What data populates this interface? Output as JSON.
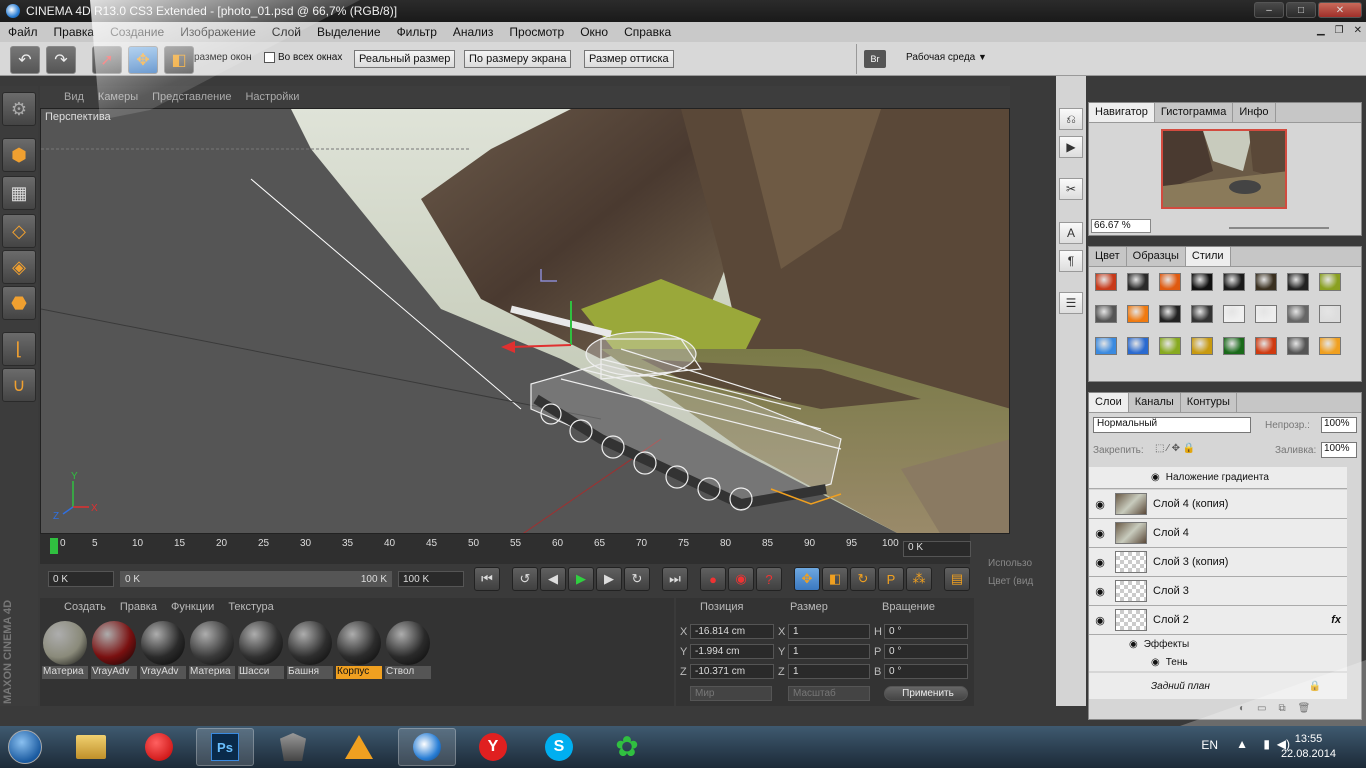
{
  "window": {
    "title": "CINEMA 4D R13.0 CS3 Extended - [photo_01.psd @ 66,7% (RGB/8)]",
    "controls": [
      "–",
      "□",
      "✕"
    ]
  },
  "menu": [
    "Файл",
    "Правка",
    "Создание",
    "Изображение",
    "Слой",
    "Выделение",
    "Фильтр",
    "Анализ",
    "Просмотр",
    "Окно",
    "Справка"
  ],
  "options": {
    "resize_windows_label": "размер окон",
    "all_windows_label": "Во всех окнах",
    "actual_size": "Реальный размер",
    "fit_screen": "По размеру экрана",
    "print_size": "Размер оттиска",
    "workspace": "Рабочая среда"
  },
  "viewport": {
    "menu": [
      "Вид",
      "Камеры",
      "Представление",
      "Настройки"
    ],
    "label": "Перспектива",
    "axes": {
      "y": "Y",
      "x": "X",
      "z": "Z"
    }
  },
  "timeline": {
    "ticks": [
      "0",
      "5",
      "10",
      "15",
      "20",
      "25",
      "30",
      "35",
      "40",
      "45",
      "50",
      "55",
      "60",
      "65",
      "70",
      "75",
      "80",
      "85",
      "90",
      "95",
      "100"
    ],
    "current_frame": "0 K"
  },
  "transport": {
    "start": "0 K",
    "range_start": "0 K",
    "range_end": "100 K",
    "end": "100 K"
  },
  "materials": {
    "menu": [
      "Создать",
      "Правка",
      "Функции",
      "Текстура"
    ],
    "items": [
      {
        "name": "Материа",
        "color": "#8a8a7a",
        "active": false
      },
      {
        "name": "VrayAdv",
        "color": "#7a1010",
        "active": false
      },
      {
        "name": "VrayAdv",
        "color": "#2a2a2a",
        "active": false
      },
      {
        "name": "Материа",
        "color": "#3a3a3a",
        "active": false
      },
      {
        "name": "Шасси",
        "color": "#303030",
        "active": false
      },
      {
        "name": "Башня",
        "color": "#2e2e2e",
        "active": false
      },
      {
        "name": "Корпус",
        "color": "#2c2c2c",
        "active": true
      },
      {
        "name": "Ствол",
        "color": "#2a2a2a",
        "active": false
      }
    ]
  },
  "coordinates": {
    "headers": [
      "Позиция",
      "Размер",
      "Вращение"
    ],
    "rows": [
      {
        "axis": "X",
        "pos": "-16.814 cm",
        "size_axis": "X",
        "size": "1",
        "rot_axis": "H",
        "rot": "0 °"
      },
      {
        "axis": "Y",
        "pos": "-1.994 cm",
        "size_axis": "Y",
        "size": "1",
        "rot_axis": "P",
        "rot": "0 °"
      },
      {
        "axis": "Z",
        "pos": "-10.371 cm",
        "size_axis": "Z",
        "size": "1",
        "rot_axis": "B",
        "rot": "0 °"
      }
    ],
    "mode_world": "Мир",
    "mode_scale": "Масштаб",
    "apply": "Применить"
  },
  "side_texts": [
    "Использо",
    "Цвет (вид"
  ],
  "maxon_logo": "MAXON CINEMA 4D",
  "navigator": {
    "tabs": [
      "Навигатор",
      "Гистограмма",
      "Инфо"
    ],
    "zoom": "66.67 %"
  },
  "swatches": {
    "tabs": [
      "Цвет",
      "Образцы",
      "Стили"
    ],
    "colors": [
      "#c83a1a",
      "#2a2a2a",
      "#e05a10",
      "#111111",
      "#1a1a1a",
      "#3a3020",
      "#222222",
      "#8aa020",
      "#555555",
      "#f07a10",
      "#222222",
      "#333333",
      "#f0f0f0",
      "#eeeeee",
      "#666666",
      "#dddddd",
      "#3a8ae0",
      "#2a6ad0",
      "#88aa20",
      "#c89a10",
      "#1a6a1a",
      "#d03a10",
      "#555555",
      "#f0a020"
    ]
  },
  "layers": {
    "tabs": [
      "Слои",
      "Каналы",
      "Контуры"
    ],
    "blend_mode": "Нормальный",
    "opacity_label": "Непрозр.:",
    "opacity": "100%",
    "lock_label": "Закрепить:",
    "fill_label": "Заливка:",
    "fill": "100%",
    "gradient_overlay": "Наложение градиента",
    "items": [
      "Слой 4 (копия)",
      "Слой 4",
      "Слой 3 (копия)",
      "Слой 3",
      "Слой 2"
    ],
    "effects_label": "Эффекты",
    "shadow_label": "Тень",
    "background_label": "Задний план",
    "fx": "fx"
  },
  "taskbar": {
    "lang": "EN",
    "time": "13:55",
    "date": "22.08.2014",
    "ps_label": "Ps"
  }
}
